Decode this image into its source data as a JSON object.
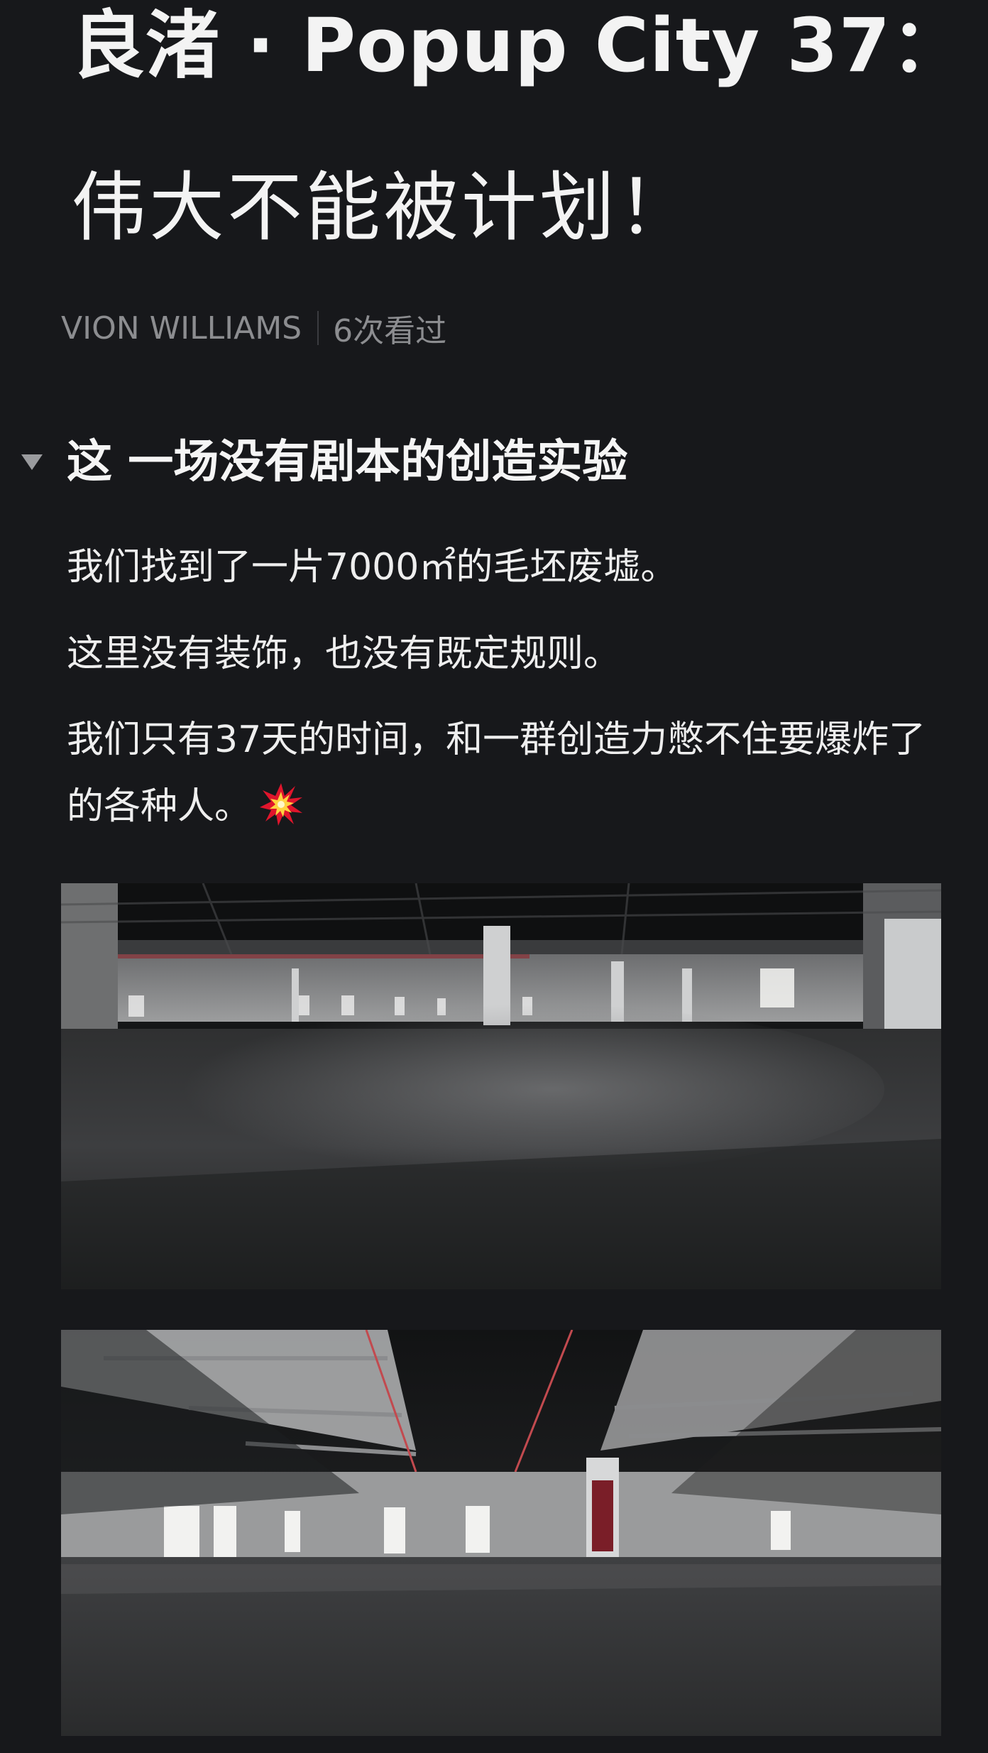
{
  "article": {
    "title_line1": "良渚 · Popup City 37：",
    "title_line2": "伟大不能被计划！",
    "author": "VION WILLIAMS",
    "views": "6次看过"
  },
  "section": {
    "heading": "这 一场没有剧本的创造实验",
    "paragraphs": [
      "我们找到了一片7000㎡的毛坯废墟。",
      "这里没有装饰，也没有既定规则。",
      "我们只有37天的时间，和一群创造力憋不住要爆炸了的各种人。"
    ],
    "emoji": "collision-burst-icon"
  },
  "photos": [
    {
      "name": "empty-concrete-hall-photo-1"
    },
    {
      "name": "empty-concrete-hall-photo-2"
    }
  ],
  "colors": {
    "background": "#17181b",
    "text": "#eeeeee",
    "meta": "#8c8d90"
  }
}
